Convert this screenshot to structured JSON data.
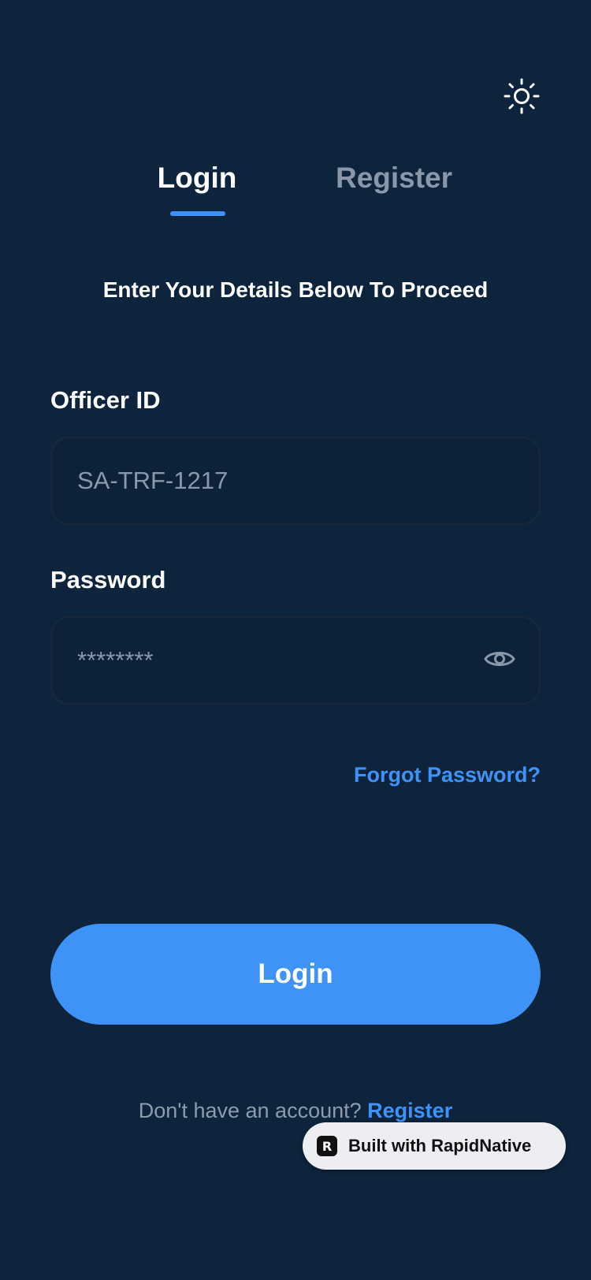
{
  "header": {
    "theme_toggle_icon": "sun-icon"
  },
  "tabs": [
    {
      "label": "Login",
      "active": true
    },
    {
      "label": "Register",
      "active": false
    }
  ],
  "subtitle": "Enter Your Details Below To Proceed",
  "form": {
    "officer_id": {
      "label": "Officer ID",
      "value": "SA-TRF-1217"
    },
    "password": {
      "label": "Password",
      "value": "********",
      "toggle_icon": "eye-icon"
    },
    "forgot_password": "Forgot Password?",
    "submit_label": "Login"
  },
  "footer": {
    "prompt": "Don't have an account?",
    "register_link": "Register"
  },
  "badge": {
    "logo_glyph": "R",
    "label": "Built with RapidNative"
  },
  "colors": {
    "background": "#0e243d",
    "accent": "#3f93f7",
    "muted_text": "#8d9bab"
  }
}
